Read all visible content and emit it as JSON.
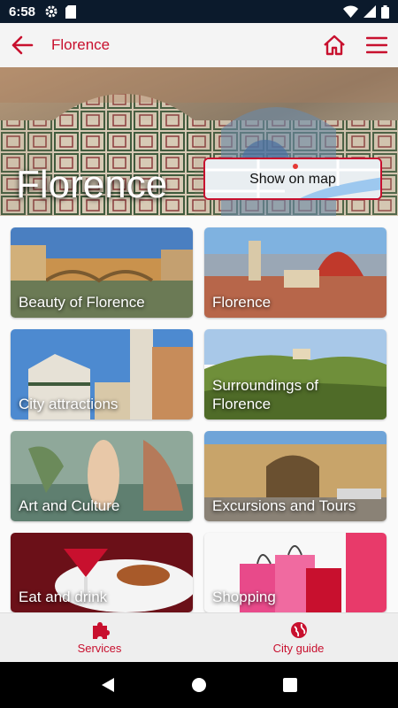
{
  "status_bar": {
    "time": "6:58"
  },
  "header": {
    "title": "Florence",
    "back_icon": "arrow-left-icon",
    "home_icon": "home-icon",
    "menu_icon": "hamburger-menu-icon"
  },
  "hero": {
    "title": "Florence",
    "map_button_label": "Show on map"
  },
  "tiles": [
    {
      "label": "Beauty of Florence"
    },
    {
      "label": "Florence"
    },
    {
      "label": "City attractions"
    },
    {
      "label": "Surroundings of Florence"
    },
    {
      "label": "Art and Culture"
    },
    {
      "label": "Excursions and Tours"
    },
    {
      "label": "Eat and drink"
    },
    {
      "label": "Shopping"
    }
  ],
  "bottom_nav": {
    "services_label": "Services",
    "city_guide_label": "City guide"
  },
  "colors": {
    "accent": "#c8102e",
    "status_bar": "#0b1a2c"
  }
}
